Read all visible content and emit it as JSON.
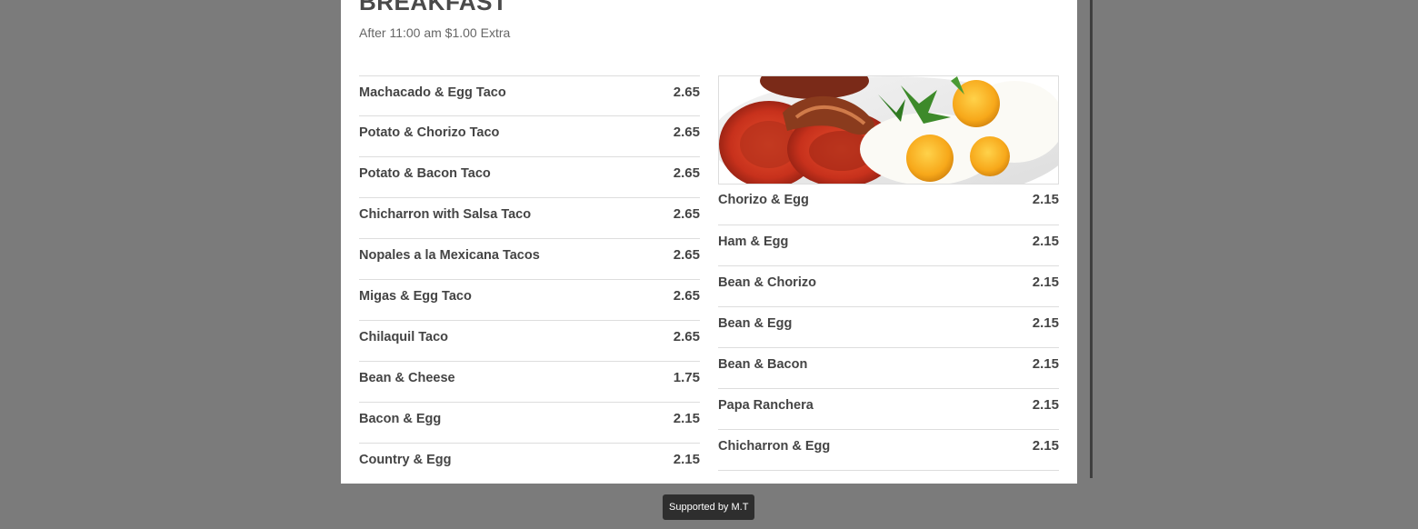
{
  "menu": {
    "title": "BREAKFAST",
    "subtitle": "After 11:00 am $1.00 Extra",
    "left_items": [
      {
        "name": "Machacado & Egg Taco",
        "price": "2.65"
      },
      {
        "name": "Potato & Chorizo Taco",
        "price": "2.65"
      },
      {
        "name": "Potato & Bacon Taco",
        "price": "2.65"
      },
      {
        "name": "Chicharron with Salsa Taco",
        "price": "2.65"
      },
      {
        "name": "Nopales a la Mexicana Tacos",
        "price": "2.65"
      },
      {
        "name": "Migas & Egg Taco",
        "price": "2.65"
      },
      {
        "name": "Chilaquil Taco",
        "price": "2.65"
      },
      {
        "name": "Bean & Cheese",
        "price": "1.75"
      },
      {
        "name": "Bacon & Egg",
        "price": "2.15"
      },
      {
        "name": "Country & Egg",
        "price": "2.15"
      }
    ],
    "right_items": [
      {
        "name": "Chorizo & Egg",
        "price": "2.15"
      },
      {
        "name": "Ham & Egg",
        "price": "2.15"
      },
      {
        "name": "Bean & Chorizo",
        "price": "2.15"
      },
      {
        "name": "Bean & Egg",
        "price": "2.15"
      },
      {
        "name": "Bean & Bacon",
        "price": "2.15"
      },
      {
        "name": "Papa Ranchera",
        "price": "2.15"
      },
      {
        "name": "Chicharron & Egg",
        "price": "2.15"
      }
    ]
  },
  "footer": {
    "credit": "Supported by M.T"
  },
  "colors": {
    "backdrop": "#7b7b7b",
    "panel": "#ffffff",
    "text": "#444444",
    "divider": "#dddddd",
    "credit_bg": "#2e2e2e"
  }
}
